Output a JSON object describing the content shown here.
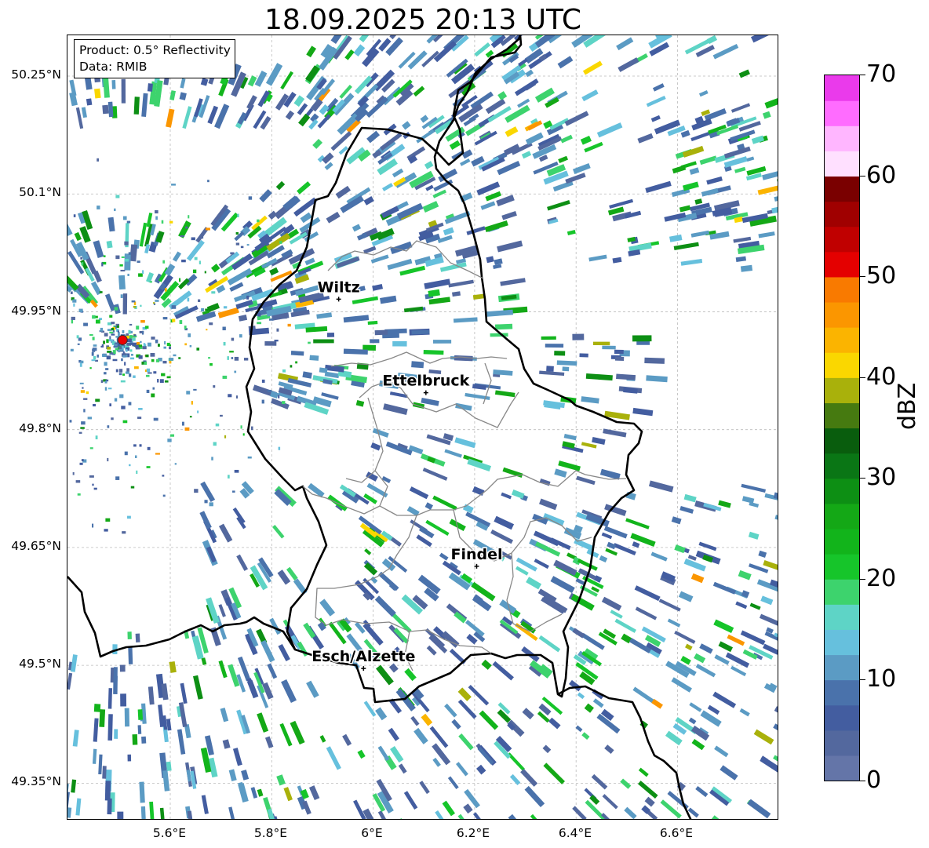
{
  "title": "18.09.2025 20:13 UTC",
  "info": {
    "product": "Product: 0.5° Reflectivity",
    "source": "Data: RMIB"
  },
  "lat_labels": [
    "50.25°N",
    "50.1°N",
    "49.95°N",
    "49.8°N",
    "49.65°N",
    "49.5°N",
    "49.35°N"
  ],
  "lon_labels": [
    "5.6°E",
    "5.8°E",
    "6°E",
    "6.2°E",
    "6.4°E",
    "6.6°E"
  ],
  "cities": [
    {
      "name": "Wiltz",
      "lon": 5.932,
      "lat": 49.966
    },
    {
      "name": "Ettelbruck",
      "lon": 6.104,
      "lat": 49.847
    },
    {
      "name": "Findel",
      "lon": 6.204,
      "lat": 49.626
    },
    {
      "name": "Esch/Alzette",
      "lon": 5.981,
      "lat": 49.496
    }
  ],
  "radar_site": {
    "lon": 5.506,
    "lat": 49.914,
    "color": "#ee0000"
  },
  "colorbar": {
    "label": "dBZ",
    "min": 0,
    "max": 70,
    "tick_labels": [
      "0",
      "10",
      "20",
      "30",
      "40",
      "50",
      "60",
      "70"
    ],
    "colors": [
      "#6475a8",
      "#53689e",
      "#435da0",
      "#4a72ab",
      "#5b9bc4",
      "#66c0dd",
      "#5ed4c6",
      "#3dd36d",
      "#16c52a",
      "#12b41b",
      "#14a816",
      "#0d8f14",
      "#0a7615",
      "#095d0d",
      "#467a10",
      "#a9b10b",
      "#fad700",
      "#fbb400",
      "#fb9600",
      "#f97a00",
      "#e40000",
      "#c00000",
      "#a00000",
      "#7a0000",
      "#ffe0ff",
      "#ffb6ff",
      "#ff6cff",
      "#ea3aeb"
    ]
  },
  "colors": {
    "border_country": "#000000",
    "border_canton": "#888888",
    "grid": "#bbbbbb"
  }
}
